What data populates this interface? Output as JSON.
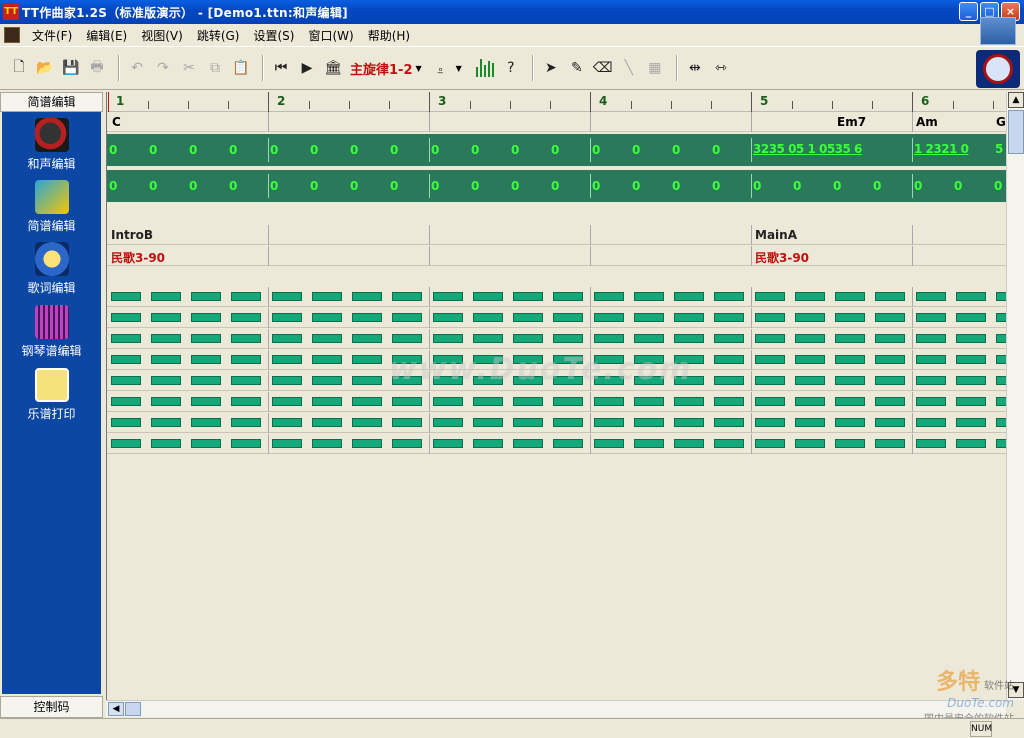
{
  "window": {
    "title": "TT作曲家1.2S（标准版演示） - [Demo1.ttn:和声编辑]",
    "app_icon_label": "TT"
  },
  "menu": [
    "文件(F)",
    "编辑(E)",
    "视图(V)",
    "跳转(G)",
    "设置(S)",
    "窗口(W)",
    "帮助(H)"
  ],
  "toolbar": {
    "track_selector": "主旋律1-2"
  },
  "left_panel": {
    "header": "简谱编辑",
    "items": [
      "和声编辑",
      "简谱编辑",
      "歌词编辑",
      "钢琴谱编辑",
      "乐谱打印"
    ],
    "footer": "控制码"
  },
  "score": {
    "bars": [
      "1",
      "2",
      "3",
      "4",
      "5",
      "6"
    ],
    "chords": [
      "C",
      "Em7",
      "Am",
      "G"
    ],
    "placeholder_note": "0",
    "melody_bar5": "3235 05 1 0535  6",
    "melody_bar6": "1 2321 0",
    "melody_tail": "5",
    "sections": [
      "IntroB",
      "MainA"
    ],
    "styles": [
      "民歌3-90",
      "民歌3-90"
    ]
  },
  "watermark": "www.DuoTe.com",
  "corner_watermark": {
    "brand": "多特",
    "sub": "软件站",
    "site": "DuoTe.com",
    "slogan": "国内最安全的软件站"
  },
  "status": {
    "num": "NUM"
  },
  "colors": {
    "panel_blue": "#0c47a4",
    "track_green": "#29795a",
    "note_green": "#3aff3a",
    "block_green": "#15a878",
    "accent_red": "#c01010"
  }
}
